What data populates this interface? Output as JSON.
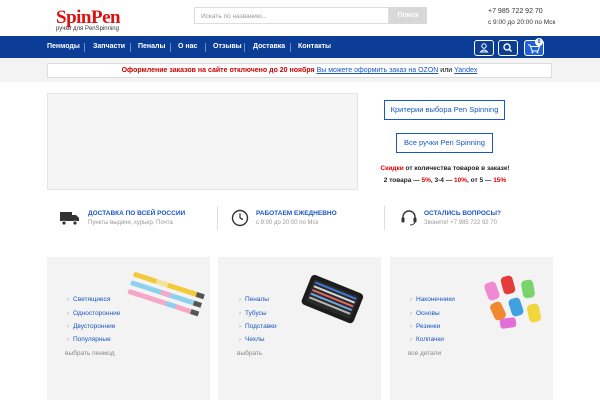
{
  "header": {
    "logo": "SpinPen",
    "tagline": "ручки для PenSpinning",
    "search_placeholder": "Искать по названию...",
    "search_button": "Поиск",
    "phone": "+7 985 722 92 70",
    "hours": "с 9:00 до 20:00 по Мск"
  },
  "nav": {
    "items": [
      "Пенмоды",
      "Запчасти",
      "Пеналы",
      "О нас",
      "Отзывы",
      "Доставка",
      "Контакты"
    ],
    "cart_count": "0"
  },
  "notice": {
    "text": "Оформление заказов на сайте отключено до 20 ноября",
    "link1": "Вы можете оформить заказ на OZON",
    "or": "или",
    "link2": "Yandex"
  },
  "right": {
    "btn1": "Критерии выбора Pen Spinning",
    "btn2": "Все ручки Pen Spinning",
    "discount_title_red": "Скидки",
    "discount_title": " от количества товаров в заказе!",
    "d1": "2 товара — ",
    "d1v": "5%",
    "d2": ", 3-4 — ",
    "d2v": "10%",
    "d3": ", от 5 — ",
    "d3v": "15%"
  },
  "features": [
    {
      "title": "ДОСТАВКА ПО ВСЕЙ РОССИИ",
      "sub": "Пункты выдачи, курьер, Почта",
      "icon": "truck-icon"
    },
    {
      "title": "РАБОТАЕМ ЕЖЕДНЕВНО",
      "sub": "с 9:00 до 20:00 по Мск",
      "icon": "clock-icon"
    },
    {
      "title": "ОСТАЛИСЬ ВОПРОСЫ?",
      "sub": "Звоните! +7 985 722 92 70",
      "icon": "headset-icon"
    }
  ],
  "cards": [
    {
      "items": [
        "Светящиеся",
        "Односторонние",
        "Двусторонние",
        "Популярные"
      ],
      "footer": "выбрать пенмод"
    },
    {
      "items": [
        "Пеналы",
        "Тубусы",
        "Подставки",
        "Чехлы"
      ],
      "footer": "выбрать"
    },
    {
      "items": [
        "Наконечники",
        "Основы",
        "Резинки",
        "Колпачки"
      ],
      "footer": "все детали"
    }
  ],
  "colors": {
    "brand": "#d11111",
    "nav": "#0b3d97",
    "link": "#1a56c4"
  }
}
